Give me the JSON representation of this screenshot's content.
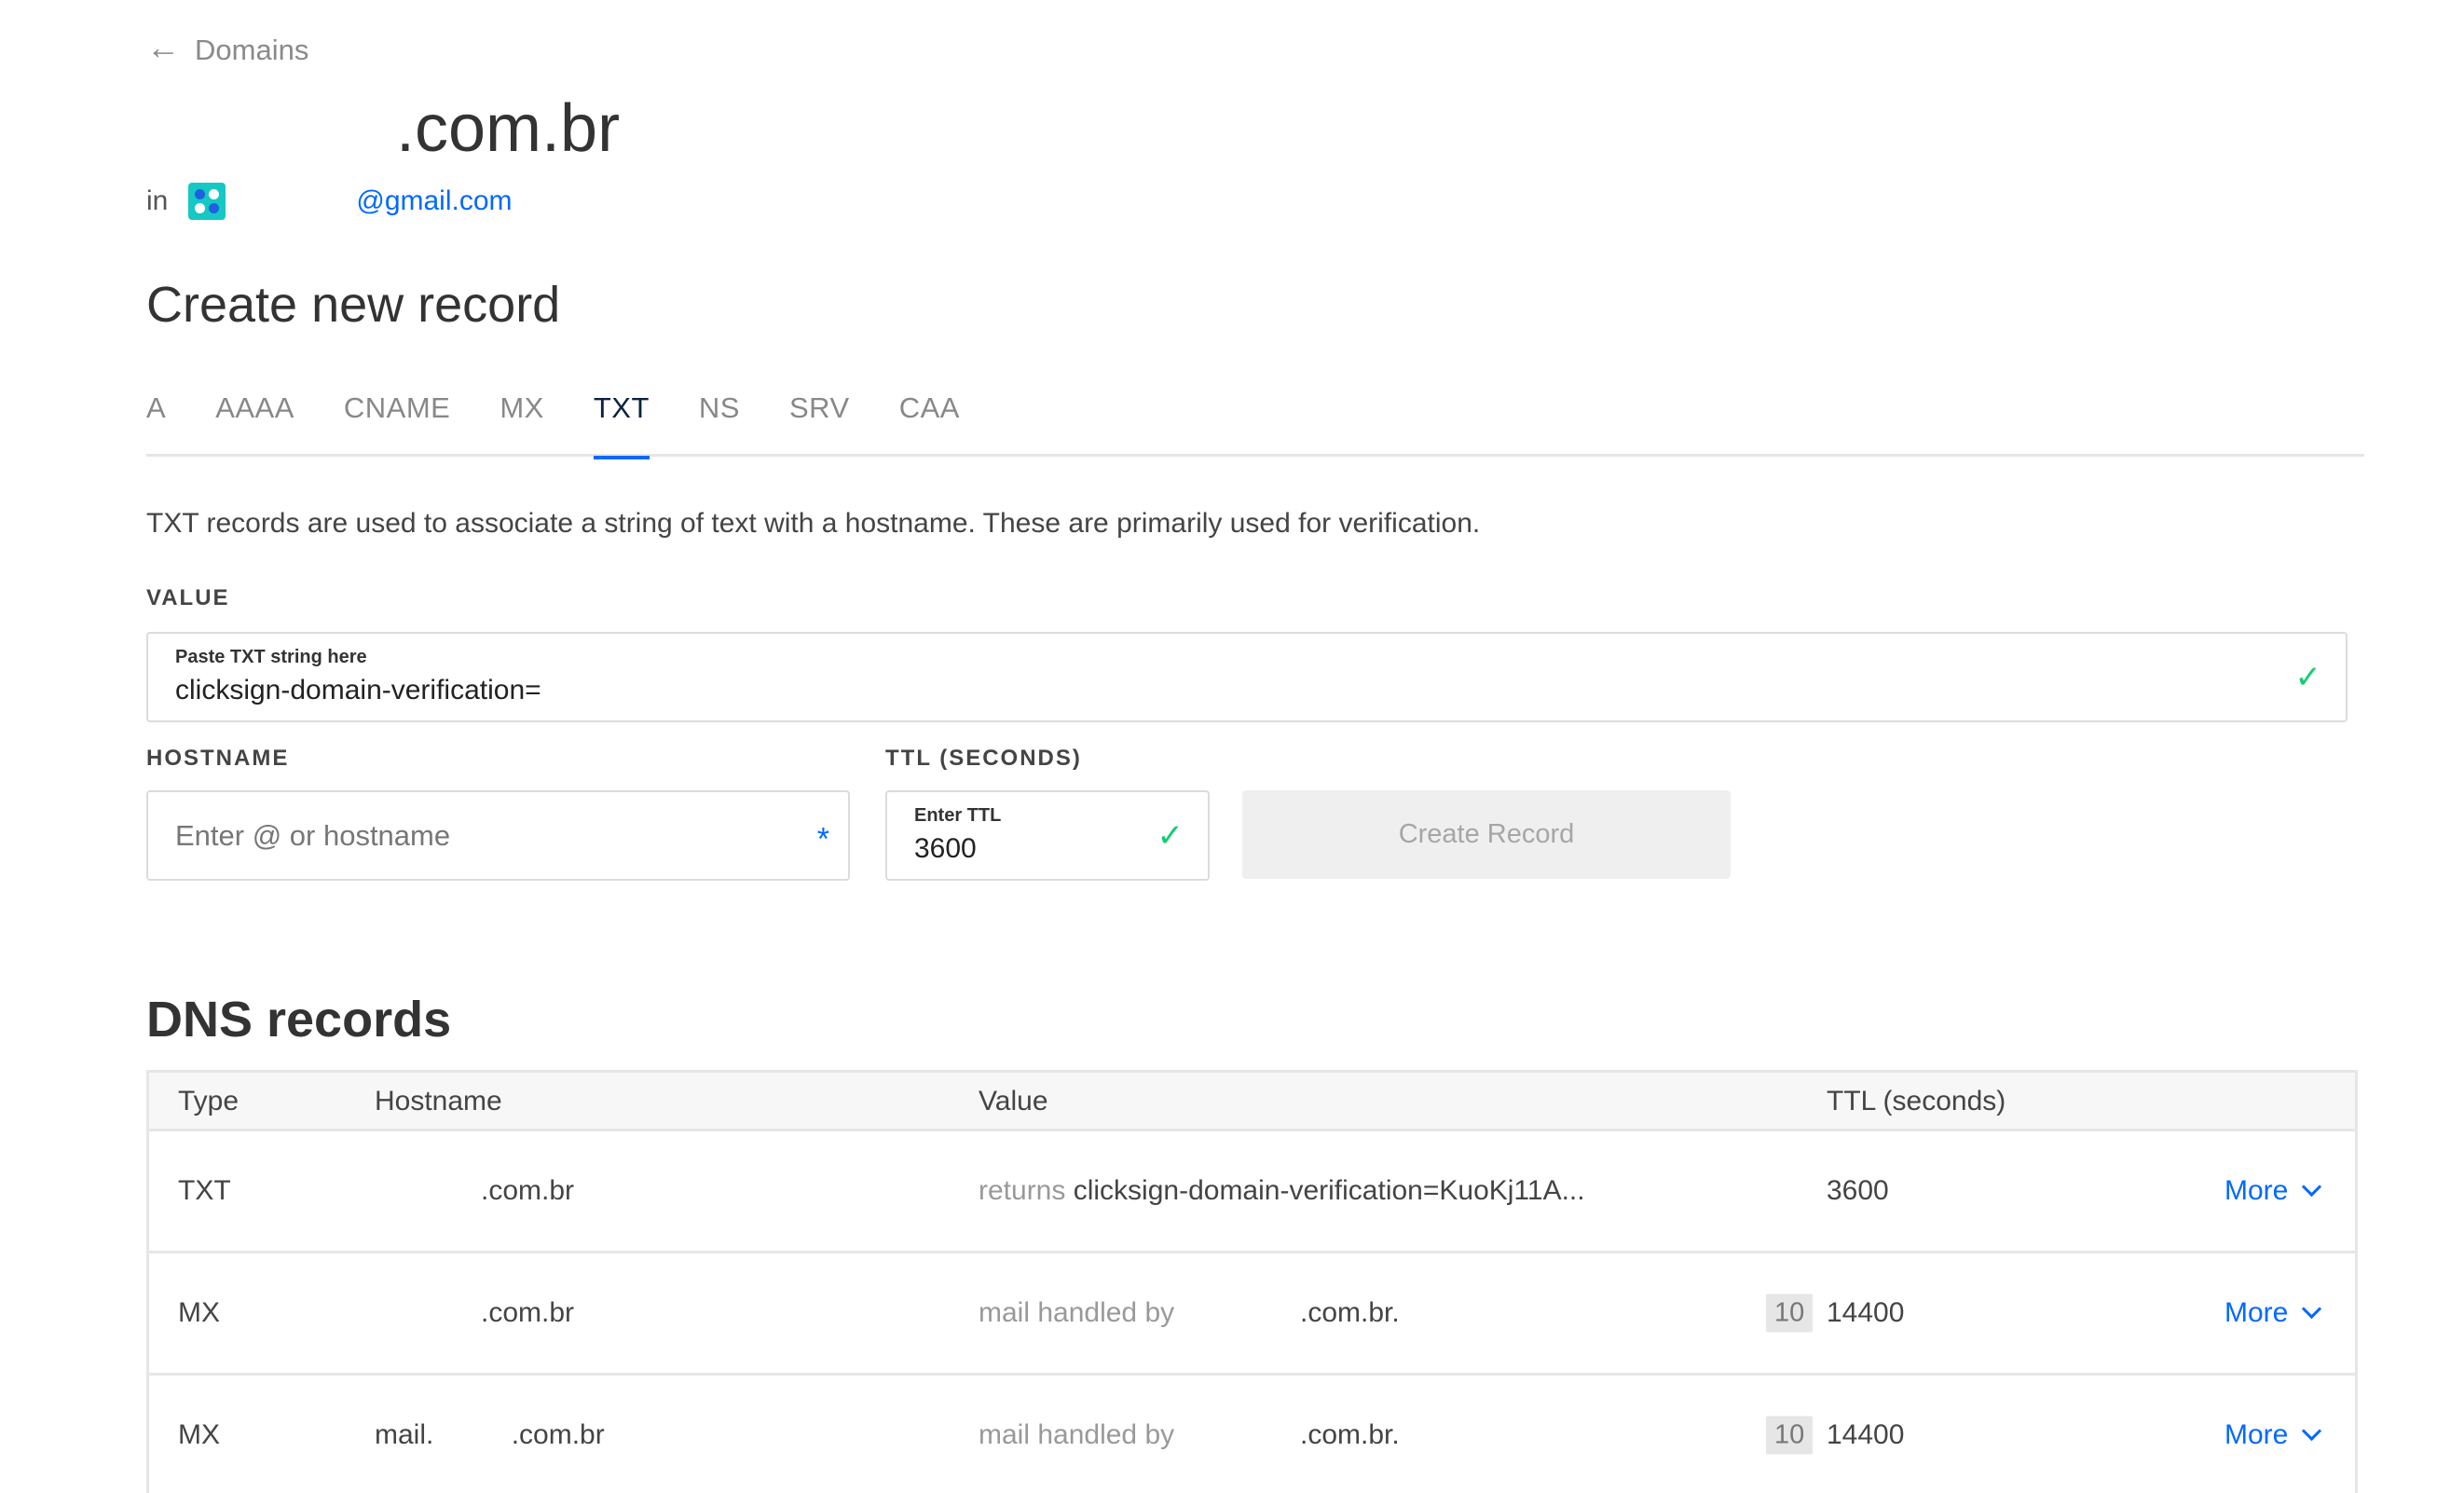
{
  "nav": {
    "back_label": "Domains"
  },
  "domain": {
    "title_suffix": ".com.br",
    "in_label": "in",
    "team_email": "@gmail.com"
  },
  "create": {
    "heading": "Create new record",
    "tabs": [
      "A",
      "AAAA",
      "CNAME",
      "MX",
      "TXT",
      "NS",
      "SRV",
      "CAA"
    ],
    "active_tab": "TXT",
    "description": "TXT records are used to associate a string of text with a hostname. These are primarily used for verification.",
    "value_label": "VALUE",
    "value_field_label": "Paste TXT string here",
    "value_field_value": "clicksign-domain-verification=",
    "hostname_label": "HOSTNAME",
    "hostname_placeholder": "Enter @ or hostname",
    "hostname_required_mark": "*",
    "ttl_label": "TTL (SECONDS)",
    "ttl_field_label": "Enter TTL",
    "ttl_field_value": "3600",
    "create_button": "Create Record",
    "check_glyph": "✓"
  },
  "dns": {
    "heading": "DNS records",
    "columns": {
      "type": "Type",
      "hostname": "Hostname",
      "value": "Value",
      "ttl": "TTL (seconds)"
    },
    "rows": [
      {
        "type": "TXT",
        "hostname": ".com.br",
        "value_prefix": "returns",
        "value": "clicksign-domain-verification=KuoKj11A...",
        "priority": "",
        "ttl": "3600",
        "action": "More"
      },
      {
        "type": "MX",
        "hostname": ".com.br",
        "value_prefix": "mail handled by",
        "value": ".com.br.",
        "priority": "10",
        "ttl": "14400",
        "action": "More"
      },
      {
        "type": "MX",
        "hostname": "mail.          .com.br",
        "value_prefix": "mail handled by",
        "value": ".com.br.",
        "priority": "10",
        "ttl": "14400",
        "action": "More"
      }
    ]
  },
  "colors": {
    "accent": "#0069ff",
    "success": "#15cd72",
    "team_icon": "#15c8c4"
  }
}
